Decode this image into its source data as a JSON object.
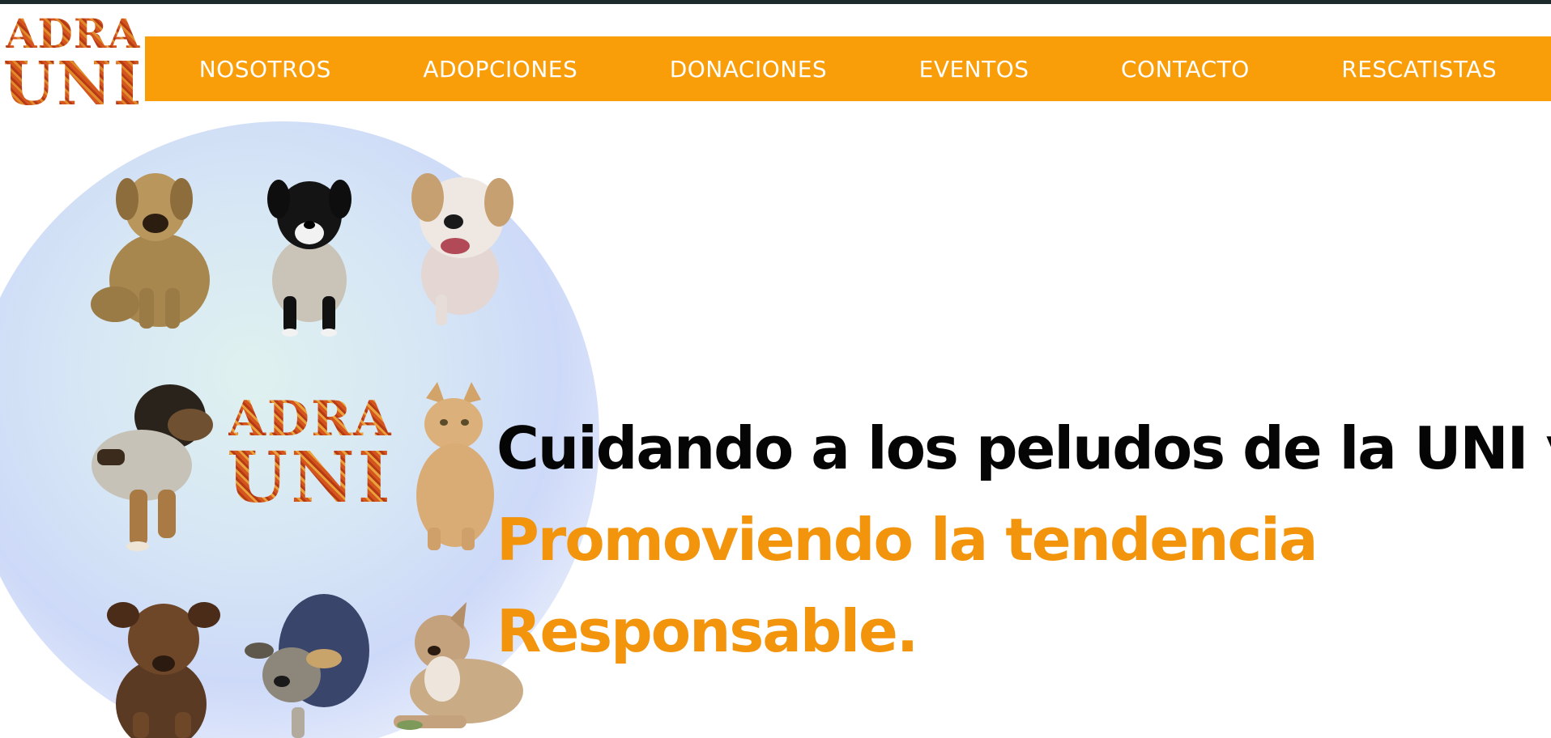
{
  "logo": {
    "line1": "ADRA",
    "line2": "UNI"
  },
  "nav": {
    "items": [
      {
        "label": "NOSOTROS"
      },
      {
        "label": "ADOPCIONES"
      },
      {
        "label": "DONACIONES"
      },
      {
        "label": "EVENTOS"
      },
      {
        "label": "CONTACTO"
      },
      {
        "label": "RESCATISTAS"
      }
    ]
  },
  "hero": {
    "logo_line1": "ADRA",
    "logo_line2": "UNI",
    "headline_line1": "Cuidando a los peludos de la UNI y",
    "headline_line2": "Promoviendo la tendencia",
    "headline_line3": "Responsable."
  },
  "colors": {
    "nav_bg": "#f99e09",
    "accent_orange": "#f2940c",
    "headline_dark": "#050505",
    "top_strip": "#1d2a2c"
  }
}
